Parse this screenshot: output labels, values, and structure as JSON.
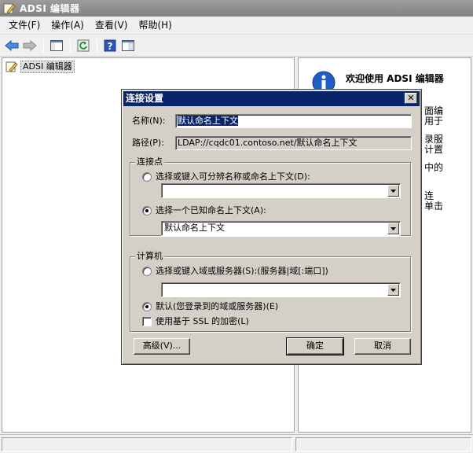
{
  "window": {
    "title": "ADSI 编辑器"
  },
  "menu": [
    "文件(F)",
    "操作(A)",
    "查看(V)",
    "帮助(H)"
  ],
  "toolbar": [
    "back-icon",
    "forward-icon",
    "show-hide-tree-icon",
    "refresh-icon",
    "help-icon",
    "properties-icon"
  ],
  "tree": {
    "root_label": "ADSI 编辑器"
  },
  "right_pane": {
    "title": "欢迎使用 ADSI 编辑器",
    "fragments": [
      "面编",
      "用于",
      "录服",
      "计置",
      "中的",
      "连",
      "单击"
    ]
  },
  "dialog": {
    "title": "连接设置",
    "close_label": "✕",
    "name_label": "名称(N):",
    "name_value": "默认命名上下文",
    "path_label": "路径(P):",
    "path_value": "LDAP://cqdc01.contoso.net/默认命名上下文",
    "connection_point": {
      "group_title": "连接点",
      "option1_label": "选择或键入可分辨名称或命名上下文(D):",
      "option1_value": "",
      "option2_label": "选择一个已知命名上下文(A):",
      "option2_value": "默认命名上下文"
    },
    "computer": {
      "group_title": "计算机",
      "option1_label": "选择或键入域或服务器(S):(服务器|域[:端口])",
      "option1_value": "",
      "option2_label": "默认(您登录到的域或服务器)(E)",
      "ssl_label": "使用基于 SSL 的加密(L)"
    },
    "buttons": {
      "advanced": "高级(V)...",
      "ok": "确定",
      "cancel": "取消"
    }
  }
}
